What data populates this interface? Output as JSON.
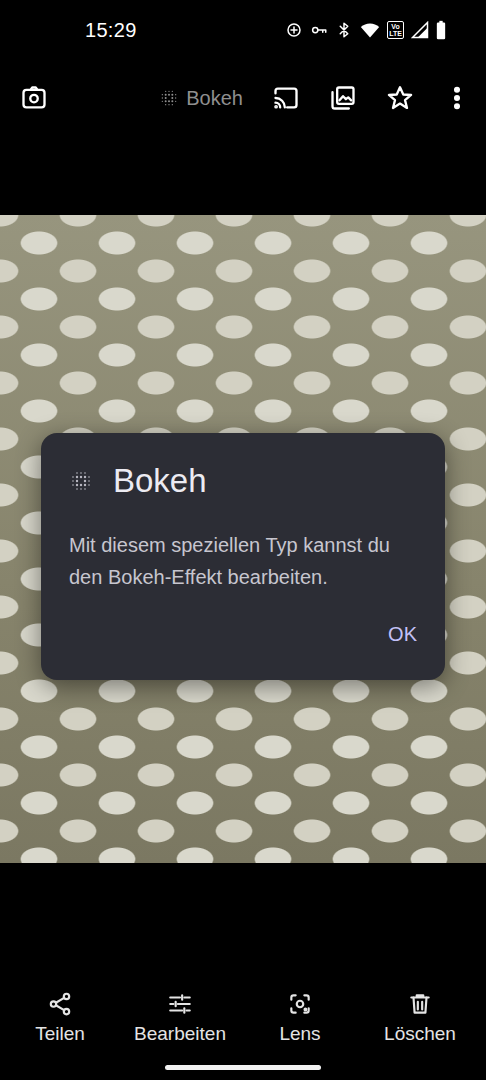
{
  "status_bar": {
    "time": "15:29",
    "volte": [
      "Vo",
      "LTE"
    ]
  },
  "toolbar": {
    "type_label": "Bokeh"
  },
  "dialog": {
    "title": "Bokeh",
    "message": "Mit diesem speziellen Typ kannst du den Bokeh-Effekt bearbeiten.",
    "button": "OK"
  },
  "actions": [
    {
      "label": "Teilen"
    },
    {
      "label": "Bearbeiten"
    },
    {
      "label": "Lens"
    },
    {
      "label": "Löschen"
    }
  ]
}
